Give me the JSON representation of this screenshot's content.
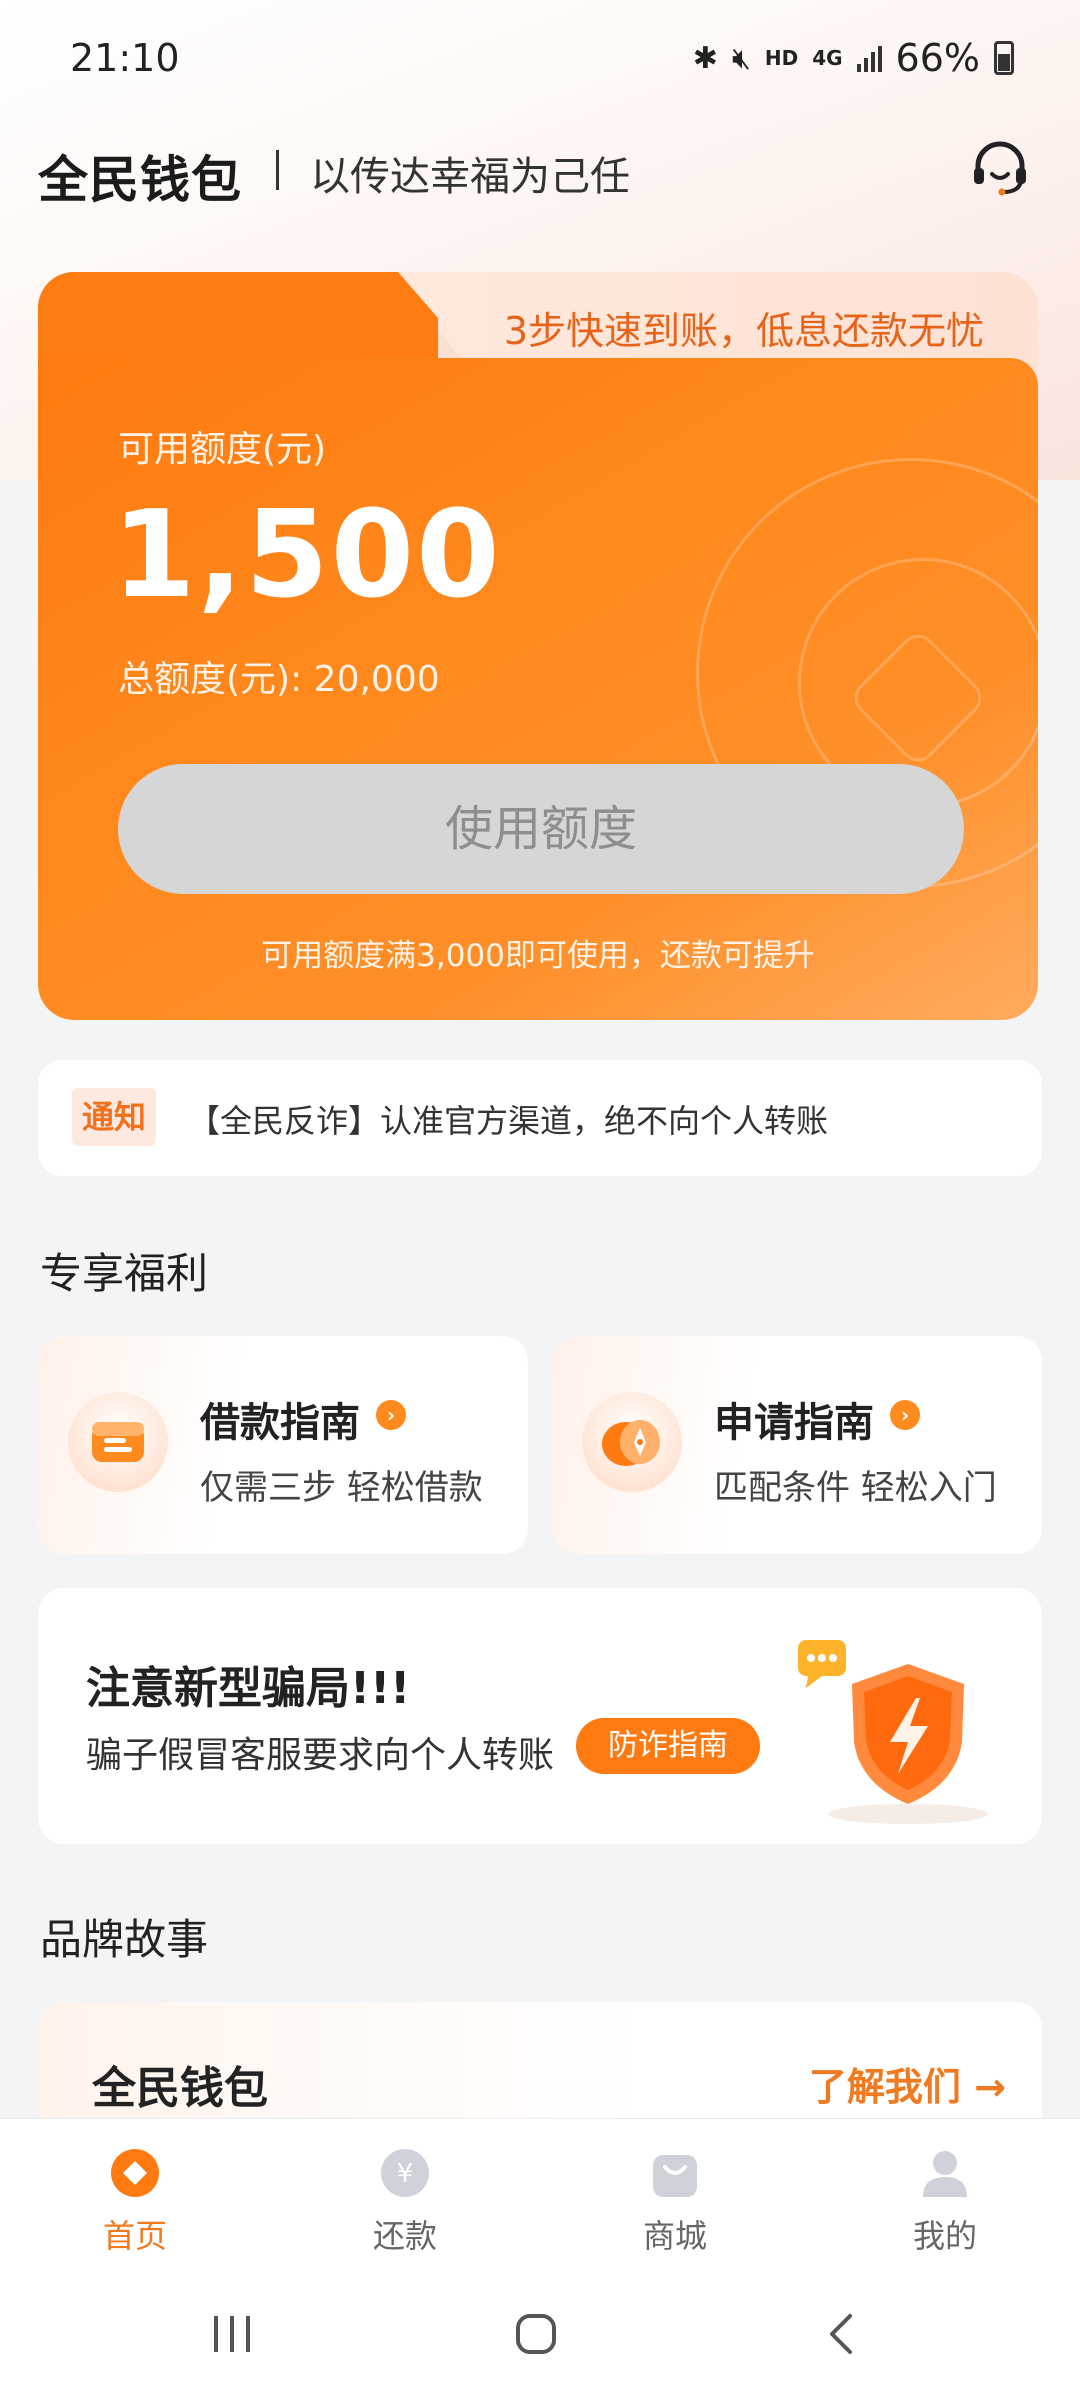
{
  "status_bar": {
    "time": "21:10",
    "network": "4G",
    "hd": "HD",
    "battery": "66%"
  },
  "header": {
    "app_name": "全民钱包",
    "slogan": "以传达幸福为己任",
    "support_icon": "headset-icon"
  },
  "credit_card": {
    "banner": "3步快速到账，低息还款无忧",
    "available_label": "可用额度(元)",
    "available_amount": "1,500",
    "total_label": "总额度(元): 20,000",
    "use_button": "使用额度",
    "hint": "可用额度满3,000即可使用，还款可提升",
    "accent_color": "#ff7a10"
  },
  "notice": {
    "tag": "通知",
    "text": "【全民反诈】认准官方渠道，绝不向个人转账"
  },
  "benefits": {
    "section_title": "专享福利",
    "items": [
      {
        "title": "借款指南",
        "subtitle": "仅需三步 轻松借款",
        "icon": "wallet-card-icon"
      },
      {
        "title": "申请指南",
        "subtitle": "匹配条件 轻松入门",
        "icon": "compass-icon"
      }
    ]
  },
  "fraud": {
    "title": "注意新型骗局!!!",
    "subtitle": "骗子假冒客服要求向个人转账",
    "button": "防诈指南",
    "icon": "shield-lightning-icon"
  },
  "brand": {
    "section_title": "品牌故事",
    "name": "全民钱包",
    "link": "了解我们 →"
  },
  "bottom_nav": {
    "items": [
      {
        "label": "首页",
        "icon": "home-icon",
        "active": true
      },
      {
        "label": "还款",
        "icon": "yuan-icon",
        "active": false
      },
      {
        "label": "商城",
        "icon": "shopping-bag-icon",
        "active": false
      },
      {
        "label": "我的",
        "icon": "user-icon",
        "active": false
      }
    ]
  }
}
